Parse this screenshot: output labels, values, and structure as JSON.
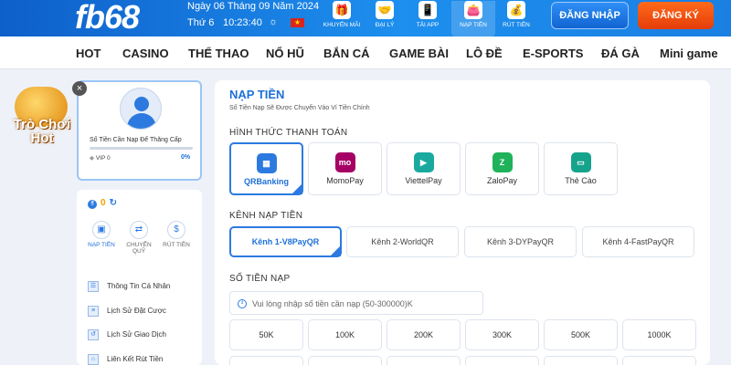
{
  "header": {
    "logo": "fb68",
    "date": "Ngày 06 Tháng 09 Năm 2024",
    "weekday": "Thứ 6",
    "time": "10:23:40",
    "icons": [
      {
        "label": "KHUYẾN MÃI",
        "icon": "gift-icon",
        "glyph": "🎁"
      },
      {
        "label": "ĐẠI LÝ",
        "icon": "handshake-icon",
        "glyph": "🤝"
      },
      {
        "label": "TẢI APP",
        "icon": "phone-icon",
        "glyph": "📱"
      },
      {
        "label": "NẠP TIỀN",
        "icon": "wallet-icon",
        "glyph": "👛"
      },
      {
        "label": "RÚT TIỀN",
        "icon": "withdraw-icon",
        "glyph": "💰"
      }
    ],
    "login_label": "ĐĂNG NHẬP",
    "register_label": "ĐĂNG KÝ",
    "colors": {
      "header_blue": "#1d8fee",
      "register_orange": "#e43d0a"
    }
  },
  "nav": [
    "HOT",
    "CASINO",
    "THỂ THAO",
    "NỔ HŨ",
    "BẮN CÁ",
    "GAME BÀI",
    "LÔ ĐỀ",
    "E-SPORTS",
    "ĐÁ GÀ",
    "Mini game"
  ],
  "promo": {
    "line1": "Trò Chơi",
    "line2": "Hot",
    "close": "×"
  },
  "profile": {
    "upgrade_text": "Số Tiền Cần Nạp Để Thăng Cấp",
    "vip": "VIP 0",
    "percent": "0%",
    "progress": 0
  },
  "wallet": {
    "balance": "0"
  },
  "actions": [
    {
      "label": "NẠP TIỀN",
      "glyph": "▣"
    },
    {
      "label": "CHUYỂN QUỸ",
      "glyph": "⇄"
    },
    {
      "label": "RÚT TIỀN",
      "glyph": "$"
    }
  ],
  "menu": [
    "Thông Tin Cá Nhân",
    "Lịch Sử Đặt Cược",
    "Lịch Sử Giao Dịch",
    "Liên Kết Rút Tiền"
  ],
  "deposit": {
    "title": "NẠP TIỀN",
    "subtitle": "Số Tiền Nạp Sẽ Được Chuyển Vào Ví Tiền Chính",
    "method_label": "HÌNH THỨC THANH TOÁN",
    "methods": [
      {
        "label": "QRBanking",
        "icon": "qr-icon",
        "glyph": "▦",
        "color": "#2c7ae0"
      },
      {
        "label": "MomoPay",
        "icon": "momo-icon",
        "glyph": "mo",
        "color": "#a50064"
      },
      {
        "label": "ViettelPay",
        "icon": "viettelpay-icon",
        "glyph": "▶",
        "color": "#1aa99f"
      },
      {
        "label": "ZaloPay",
        "icon": "zalopay-icon",
        "glyph": "Z",
        "color": "#1fb25a"
      },
      {
        "label": "Thẻ Cào",
        "icon": "card-icon",
        "glyph": "▭",
        "color": "#16a38c"
      }
    ],
    "channel_label": "KÊNH NẠP TIỀN",
    "channels": [
      "Kênh 1-V8PayQR",
      "Kênh 2-WorldQR",
      "Kênh 3-DYPayQR",
      "Kênh 4-FastPayQR"
    ],
    "amount_label": "SỐ TIỀN NẠP",
    "amount_placeholder": "Vui lòng nhập số tiền cần nạp (50-300000)K",
    "amounts": [
      "50K",
      "100K",
      "200K",
      "300K",
      "500K",
      "1000K"
    ]
  }
}
